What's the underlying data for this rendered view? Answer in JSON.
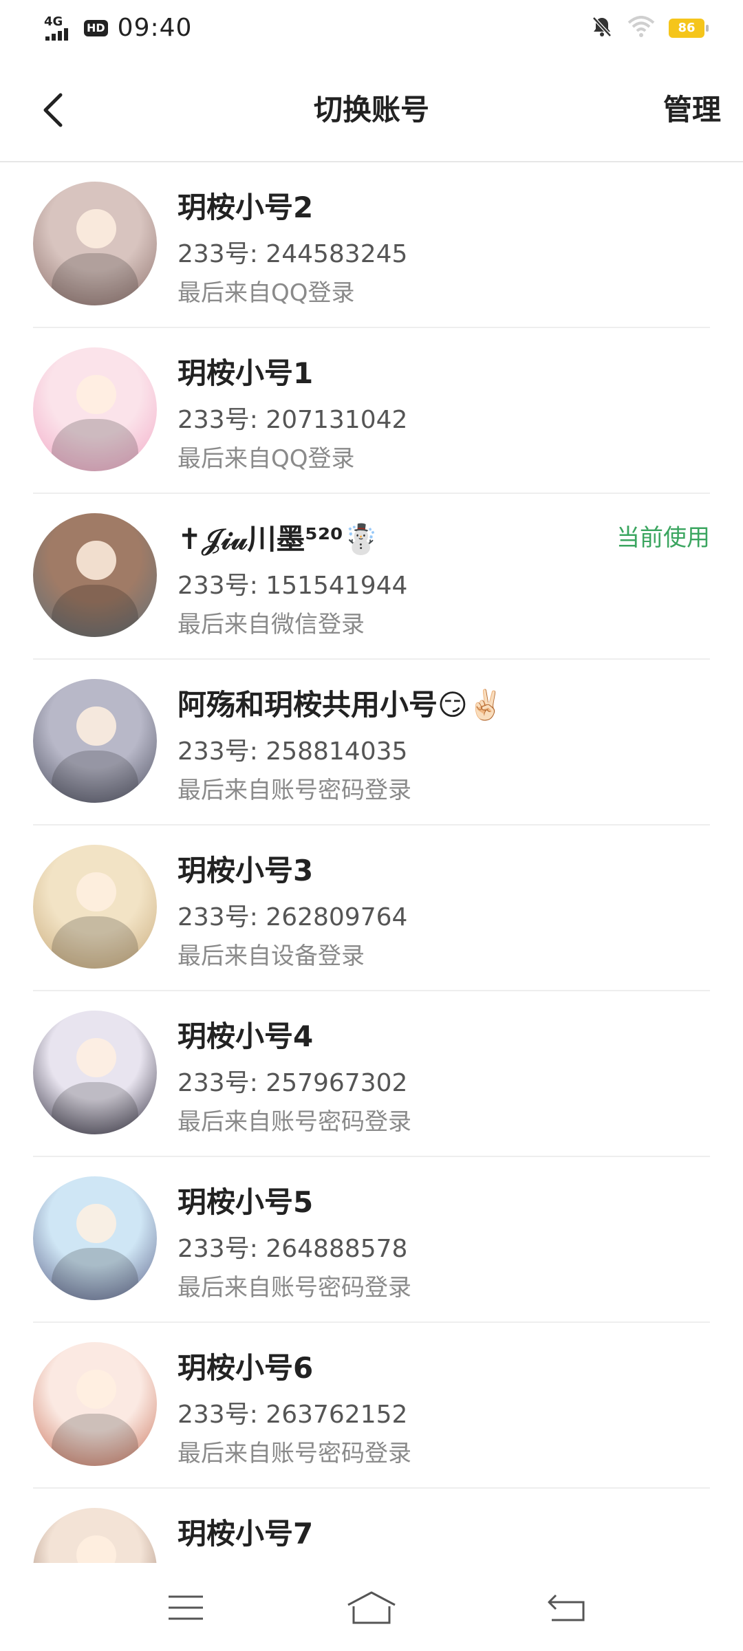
{
  "status_bar": {
    "network": "4G",
    "hd": "HD",
    "time": "09:40",
    "battery": "86",
    "icons": [
      "signal-icon",
      "hd-icon",
      "mute-bell-icon",
      "wifi-icon",
      "battery-icon"
    ]
  },
  "nav": {
    "title": "切换账号",
    "manage": "管理",
    "back_icon": "chevron-left-icon"
  },
  "accounts": [
    {
      "name": "玥桉小号2",
      "id": "233号: 244583245",
      "login": "最后来自QQ登录",
      "current": "",
      "avatar_colors": [
        "#d8c4bf",
        "#8b6f6a"
      ]
    },
    {
      "name": "玥桉小号1",
      "id": "233号: 207131042",
      "login": "最后来自QQ登录",
      "current": "",
      "avatar_colors": [
        "#fbe3ea",
        "#f1a7c5"
      ]
    },
    {
      "name": "✝𝒥𝒾𝓊川墨⁵²⁰☃️",
      "id": "233号: 151541944",
      "login": "最后来自微信登录",
      "current": "当前使用",
      "avatar_colors": [
        "#a07b66",
        "#5e6f78"
      ]
    },
    {
      "name": "阿殇和玥桉共用小号😏✌🏻",
      "id": "233号: 258814035",
      "login": "最后来自账号密码登录",
      "current": "",
      "avatar_colors": [
        "#b8b8c8",
        "#4a4c5c"
      ]
    },
    {
      "name": "玥桉小号3",
      "id": "233号: 262809764",
      "login": "最后来自设备登录",
      "current": "",
      "avatar_colors": [
        "#f2e3c5",
        "#c7a97a"
      ]
    },
    {
      "name": "玥桉小号4",
      "id": "233号: 257967302",
      "login": "最后来自账号密码登录",
      "current": "",
      "avatar_colors": [
        "#e8e4ef",
        "#2d2a3a"
      ]
    },
    {
      "name": "玥桉小号5",
      "id": "233号: 264888578",
      "login": "最后来自账号密码登录",
      "current": "",
      "avatar_colors": [
        "#cfe6f5",
        "#5a5f86"
      ]
    },
    {
      "name": "玥桉小号6",
      "id": "233号: 263762152",
      "login": "最后来自账号密码登录",
      "current": "",
      "avatar_colors": [
        "#fbe9e2",
        "#c9735b"
      ]
    },
    {
      "name": "玥桉小号7",
      "id": "",
      "login": "",
      "current": "",
      "avatar_colors": [
        "#f3e3d6",
        "#8c6a58"
      ]
    }
  ],
  "bottom_nav": {
    "icons": [
      "menu-icon",
      "home-icon",
      "back-icon"
    ]
  }
}
